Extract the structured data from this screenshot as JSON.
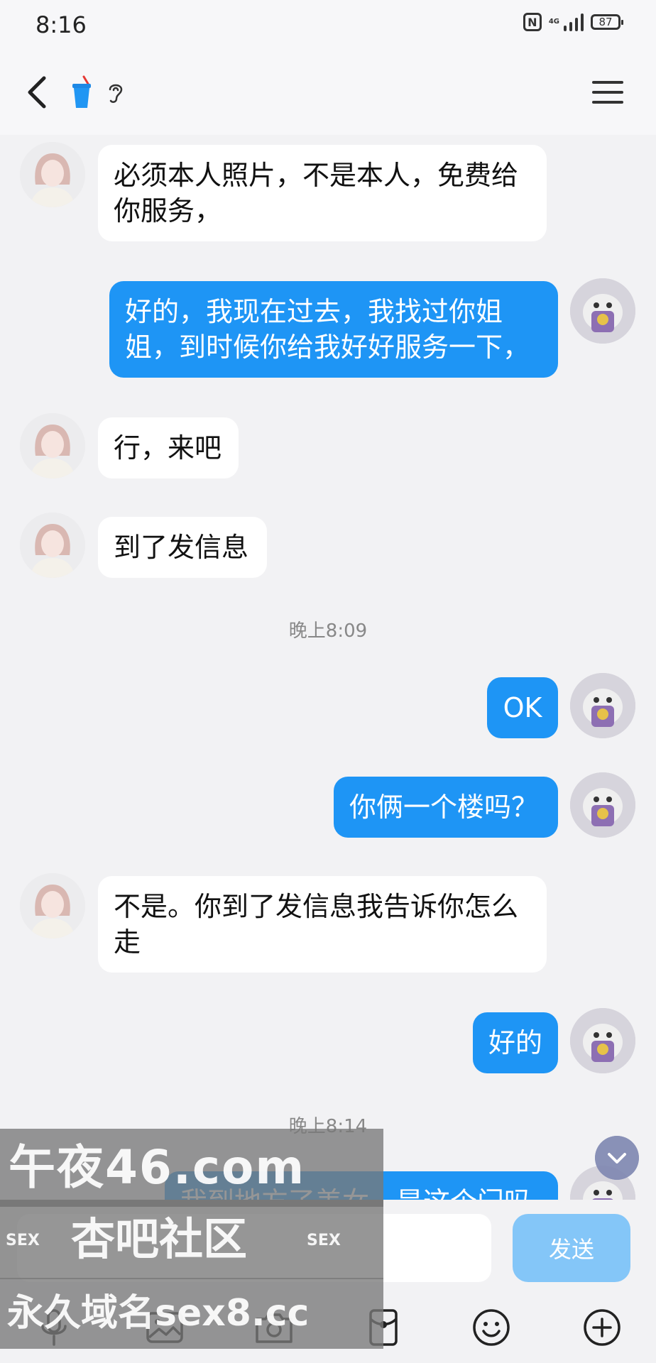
{
  "status_bar": {
    "time": "8:16",
    "network": "4G",
    "battery": "87"
  },
  "messages": [
    {
      "side": "in",
      "text": "必须本人照片，不是本人，免费给你服务，"
    },
    {
      "side": "out",
      "text": "好的，我现在过去，我找过你姐姐，到时候你给我好好服务一下，"
    },
    {
      "side": "in",
      "text": "行，来吧"
    },
    {
      "side": "in",
      "text": "到了发信息"
    },
    {
      "side": "time",
      "text": "晚上8:09"
    },
    {
      "side": "out",
      "text": "OK"
    },
    {
      "side": "out",
      "text": "你俩一个楼吗？"
    },
    {
      "side": "in",
      "text": "不是。你到了发信息我告诉你怎么走"
    },
    {
      "side": "out",
      "text": "好的"
    },
    {
      "side": "time",
      "text": "晚上8:14"
    },
    {
      "side": "out",
      "text": "我到地方了美女，是这个门吗"
    }
  ],
  "input": {
    "placeholder": "",
    "send_label": "发送"
  },
  "watermark": {
    "line1": "午夜46.com",
    "line2": "杏吧社区",
    "line3": "永久域名sex8.cc",
    "tag_left": "SEX",
    "tag_right": "SEX"
  },
  "colors": {
    "outgoing_bubble": "#1e95f5",
    "incoming_bubble": "#ffffff",
    "send_button": "#84c6f8",
    "background": "#f2f2f4"
  },
  "icons": [
    "back-arrow-icon",
    "cup-icon",
    "ear-icon",
    "menu-icon",
    "chevron-down-icon",
    "microphone-icon",
    "image-icon",
    "camera-icon",
    "red-packet-icon",
    "emoji-icon",
    "plus-icon"
  ]
}
